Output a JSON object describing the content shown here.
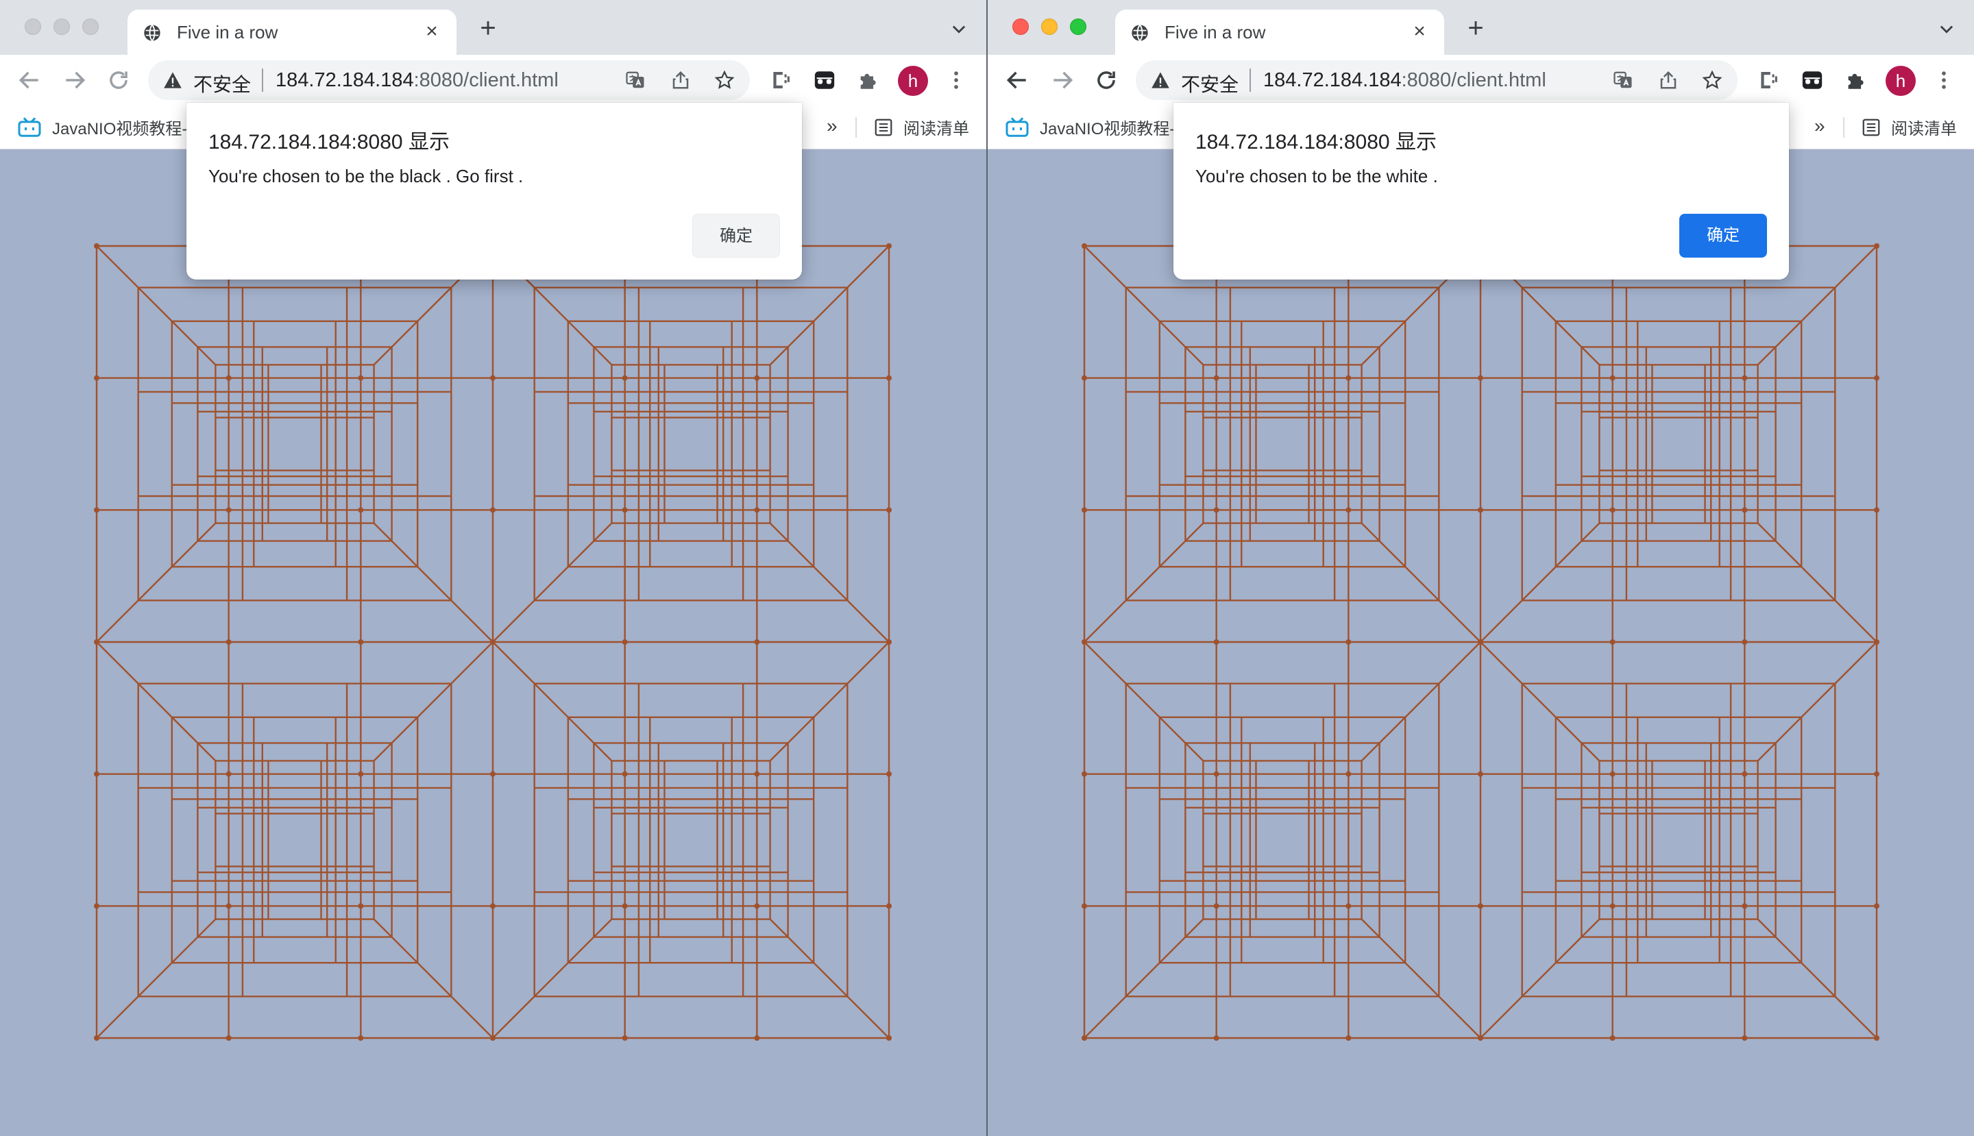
{
  "tab": {
    "title": "Five in a row",
    "close_glyph": "×",
    "new_tab_glyph": "+"
  },
  "omnibox": {
    "security_label": "不安全",
    "url_host": "184.72.184.184",
    "url_rest": ":8080/client.html"
  },
  "profile": {
    "initial": "h"
  },
  "bookmarks": {
    "item": "JavaNIO视频教程-",
    "more": "»",
    "reading_list": "阅读清单"
  },
  "windows": [
    {
      "focused": false,
      "dialog": {
        "title": "184.72.184.184:8080 显示",
        "message": "You're chosen to be the black . Go first .",
        "ok": "确定"
      }
    },
    {
      "focused": true,
      "dialog": {
        "title": "184.72.184.184:8080 显示",
        "message": "You're chosen to be the white .",
        "ok": "确定"
      }
    }
  ],
  "colors": {
    "board_background": "#a3b1cb",
    "grid_line": "#a0522d",
    "accent_button": "#1a73e8",
    "avatar": "#b5184f"
  },
  "icons": [
    "globe-icon",
    "close-icon",
    "plus-icon",
    "chevron-down-icon",
    "back-arrow-icon",
    "forward-arrow-icon",
    "reload-icon",
    "warning-icon",
    "translate-icon",
    "share-icon",
    "star-icon",
    "extension-c-icon",
    "extension-mask-icon",
    "puzzle-icon",
    "kebab-menu-icon",
    "bookmark-app-icon",
    "reading-list-icon"
  ]
}
